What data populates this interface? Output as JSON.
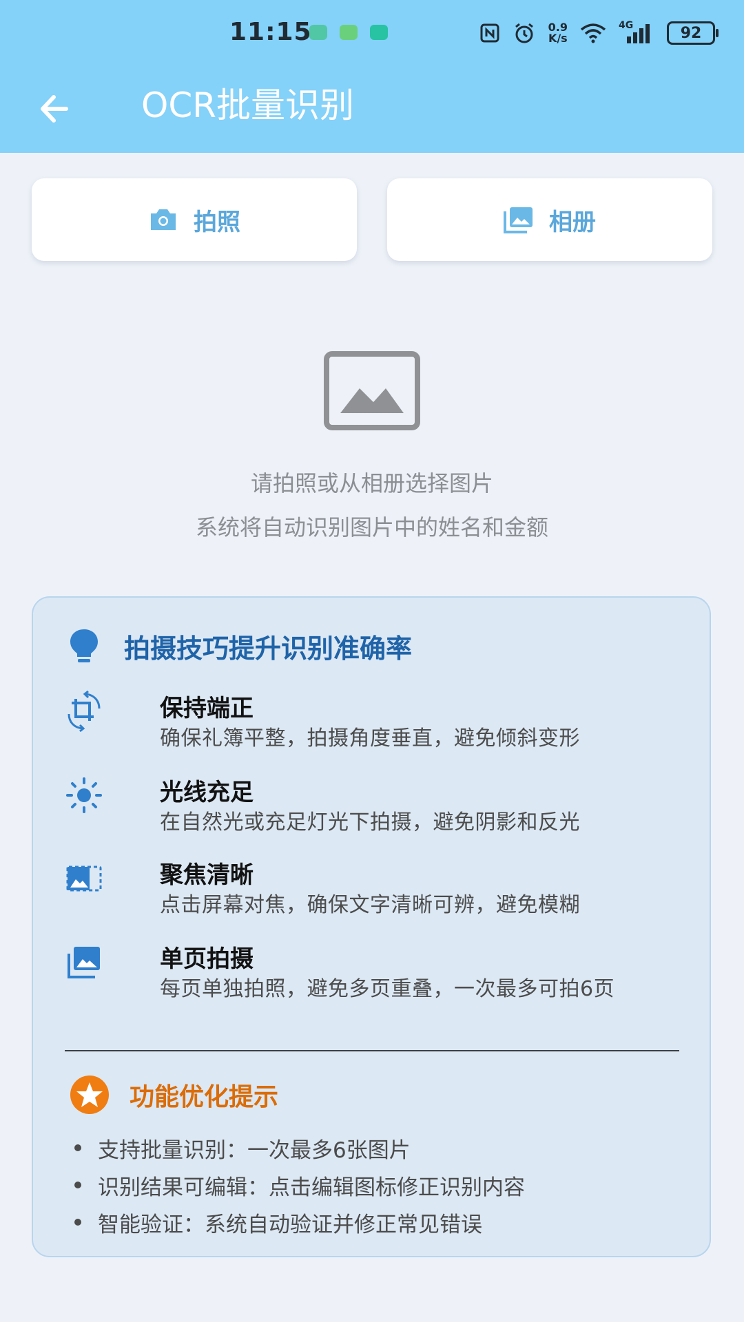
{
  "status_bar": {
    "time": "11:15",
    "network_speed_top": "0.9",
    "network_speed_bottom": "K/s",
    "network_type": "4G",
    "battery": "92",
    "mini_icon_colors": [
      "#52c7a5",
      "#6bd07b",
      "#27c3a2"
    ]
  },
  "app_bar": {
    "title": "OCR批量识别",
    "back_icon": "arrow-left-icon"
  },
  "actions": {
    "camera_label": "拍照",
    "album_label": "相册",
    "camera_icon": "camera-icon",
    "album_icon": "photo-library-icon"
  },
  "empty_state": {
    "icon": "image-placeholder-icon",
    "line1": "请拍照或从相册选择图片",
    "line2": "系统将自动识别图片中的姓名和金额"
  },
  "tips": {
    "title": "拍摄技巧提升识别准确率",
    "title_icon": "lightbulb-icon",
    "items": [
      {
        "icon": "crop-rotate-icon",
        "title": "保持端正",
        "desc": "确保礼簿平整，拍摄角度垂直，避免倾斜变形"
      },
      {
        "icon": "sun-icon",
        "title": "光线充足",
        "desc": "在自然光或充足灯光下拍摄，避免阴影和反光"
      },
      {
        "icon": "focus-image-icon",
        "title": "聚焦清晰",
        "desc": "点击屏幕对焦，确保文字清晰可辨，避免模糊"
      },
      {
        "icon": "photo-library-icon",
        "title": "单页拍摄",
        "desc": "每页单独拍照，避免多页重叠，一次最多可拍6页"
      }
    ]
  },
  "optimization": {
    "title": "功能优化提示",
    "icon": "star-icon",
    "bullets": [
      "支持批量识别：一次最多6张图片",
      "识别结果可编辑：点击编辑图标修正识别内容",
      "智能验证：系统自动验证并修正常见错误"
    ]
  },
  "colors": {
    "header_bg": "#84d1f9",
    "accent_blue": "#5aa7db",
    "tips_title": "#1f63a8",
    "tip_icon_blue": "#2f7fcc",
    "orange": "#db6c07"
  }
}
